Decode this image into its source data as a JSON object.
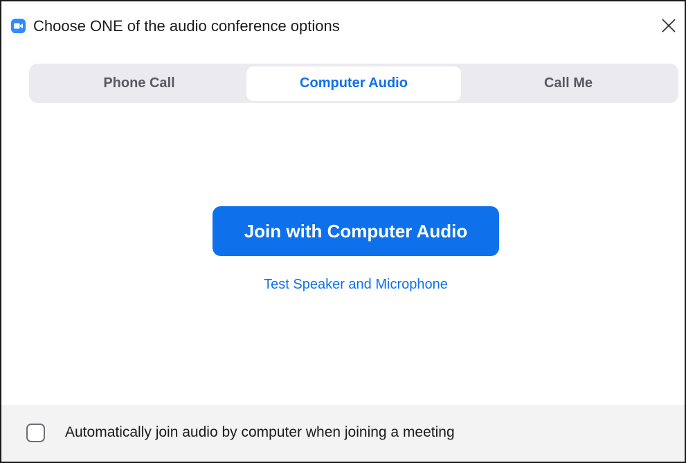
{
  "window": {
    "title": "Choose ONE of the audio conference options",
    "app_icon": "zoom-video-camera-icon",
    "close_icon": "close-icon"
  },
  "tabs": [
    {
      "label": "Phone Call",
      "active": false
    },
    {
      "label": "Computer Audio",
      "active": true
    },
    {
      "label": "Call Me",
      "active": false
    }
  ],
  "main": {
    "join_button_label": "Join with Computer Audio",
    "test_link_label": "Test Speaker and Microphone"
  },
  "footer": {
    "auto_join_label": "Automatically join audio by computer when joining a meeting",
    "auto_join_checked": false
  },
  "colors": {
    "accent": "#0e71eb",
    "logo": "#2d8cff",
    "tab_track": "#ebebef",
    "footer_bg": "#f3f3f3"
  }
}
